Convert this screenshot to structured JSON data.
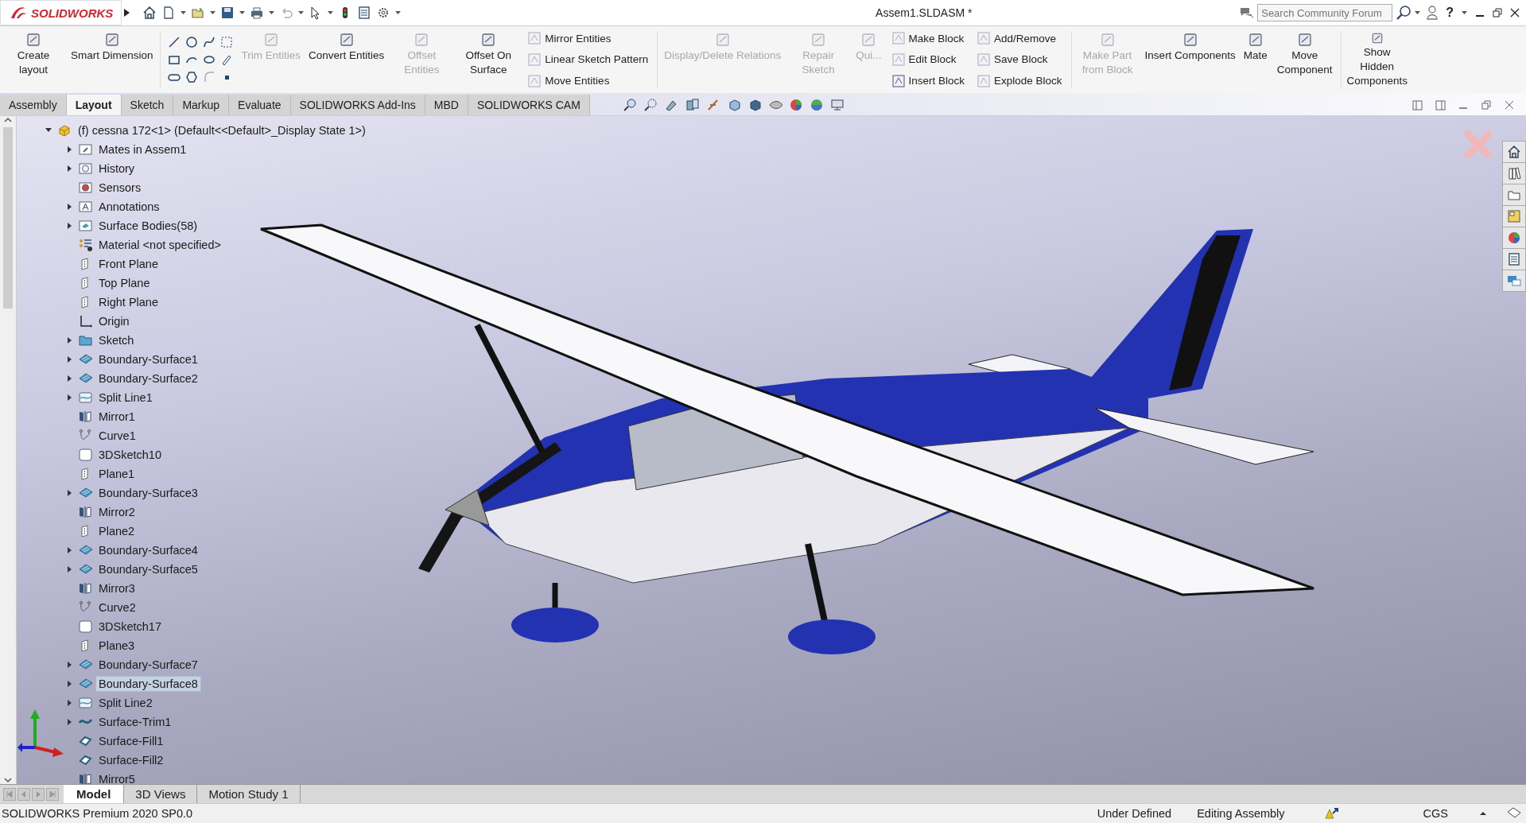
{
  "title_bar": {
    "app": "SOLIDWORKS",
    "document": "Assem1.SLDASM *",
    "search": {
      "placeholder": "Search Community Forum"
    },
    "help": "?"
  },
  "ribbon": [
    {
      "kind": "large",
      "label": "Create layout",
      "disabled": false
    },
    {
      "kind": "large",
      "label": "Smart Dimension",
      "disabled": false
    },
    {
      "kind": "sketch-tools"
    },
    {
      "kind": "large",
      "label": "Trim Entities",
      "disabled": true
    },
    {
      "kind": "large",
      "label": "Convert Entities",
      "disabled": false
    },
    {
      "kind": "large",
      "label": "Offset Entities",
      "disabled": true
    },
    {
      "kind": "large",
      "label": "Offset On Surface",
      "disabled": false
    },
    {
      "kind": "stack",
      "items": [
        {
          "label": "Mirror Entities",
          "disabled": true
        },
        {
          "label": "Linear Sketch Pattern",
          "disabled": true
        },
        {
          "label": "Move Entities",
          "disabled": true
        }
      ]
    },
    {
      "kind": "large",
      "label": "Display/Delete Relations",
      "disabled": true
    },
    {
      "kind": "large",
      "label": "Repair Sketch",
      "disabled": true
    },
    {
      "kind": "large",
      "label": "Qui...",
      "disabled": true
    },
    {
      "kind": "stack",
      "items": [
        {
          "label": "Make Block",
          "disabled": true
        },
        {
          "label": "Edit Block",
          "disabled": true
        },
        {
          "label": "Insert Block",
          "disabled": false
        }
      ]
    },
    {
      "kind": "stack",
      "items": [
        {
          "label": "Add/Remove",
          "disabled": true
        },
        {
          "label": "Save Block",
          "disabled": true
        },
        {
          "label": "Explode Block",
          "disabled": true
        }
      ]
    },
    {
      "kind": "large",
      "label": "Make Part from Block",
      "disabled": true
    },
    {
      "kind": "large",
      "label": "Insert Components",
      "disabled": false
    },
    {
      "kind": "large",
      "label": "Mate",
      "disabled": false
    },
    {
      "kind": "large",
      "label": "Move Component",
      "disabled": false
    },
    {
      "kind": "large",
      "label": "Show Hidden Components",
      "disabled": false
    }
  ],
  "command_tabs": [
    {
      "label": "Assembly",
      "selected": false
    },
    {
      "label": "Layout",
      "selected": true
    },
    {
      "label": "Sketch",
      "selected": false
    },
    {
      "label": "Markup",
      "selected": false
    },
    {
      "label": "Evaluate",
      "selected": false
    },
    {
      "label": "SOLIDWORKS Add-Ins",
      "selected": false
    },
    {
      "label": "MBD",
      "selected": false
    },
    {
      "label": "SOLIDWORKS CAM",
      "selected": false
    }
  ],
  "tree": {
    "label": "(f) cessna 172<1> (Default<<Default>_Display State 1>)",
    "kind": "part",
    "expanded": true,
    "selected": false,
    "children": [
      {
        "label": "Mates in Assem1",
        "kind": "mates",
        "expanded": false,
        "selected": false
      },
      {
        "label": "History",
        "kind": "history",
        "expanded": false,
        "selected": false
      },
      {
        "label": "Sensors",
        "kind": "sensors",
        "selected": false
      },
      {
        "label": "Annotations",
        "kind": "annotations",
        "expanded": false,
        "selected": false
      },
      {
        "label": "Surface Bodies(58)",
        "kind": "bodies",
        "expanded": false,
        "selected": false
      },
      {
        "label": "Material <not specified>",
        "kind": "material",
        "selected": false
      },
      {
        "label": "Front Plane",
        "kind": "plane",
        "selected": false
      },
      {
        "label": "Top Plane",
        "kind": "plane",
        "selected": false
      },
      {
        "label": "Right Plane",
        "kind": "plane",
        "selected": false
      },
      {
        "label": "Origin",
        "kind": "origin",
        "selected": false
      },
      {
        "label": "Sketch",
        "kind": "folder",
        "expanded": false,
        "selected": false
      },
      {
        "label": "Boundary-Surface1",
        "kind": "surface",
        "expanded": false,
        "selected": false
      },
      {
        "label": "Boundary-Surface2",
        "kind": "surface",
        "expanded": false,
        "selected": false
      },
      {
        "label": "Split Line1",
        "kind": "split",
        "expanded": false,
        "selected": false
      },
      {
        "label": "Mirror1",
        "kind": "mirror",
        "selected": false
      },
      {
        "label": "Curve1",
        "kind": "curve",
        "selected": false
      },
      {
        "label": "3DSketch10",
        "kind": "sketch3d",
        "selected": false
      },
      {
        "label": "Plane1",
        "kind": "plane",
        "selected": false
      },
      {
        "label": "Boundary-Surface3",
        "kind": "surface",
        "expanded": false,
        "selected": false
      },
      {
        "label": "Mirror2",
        "kind": "mirror",
        "selected": false
      },
      {
        "label": "Plane2",
        "kind": "plane",
        "selected": false
      },
      {
        "label": "Boundary-Surface4",
        "kind": "surface",
        "expanded": false,
        "selected": false
      },
      {
        "label": "Boundary-Surface5",
        "kind": "surface",
        "expanded": false,
        "selected": false
      },
      {
        "label": "Mirror3",
        "kind": "mirror",
        "selected": false
      },
      {
        "label": "Curve2",
        "kind": "curve",
        "selected": false
      },
      {
        "label": "3DSketch17",
        "kind": "sketch3d",
        "selected": false
      },
      {
        "label": "Plane3",
        "kind": "plane",
        "selected": false
      },
      {
        "label": "Boundary-Surface7",
        "kind": "surface",
        "expanded": false,
        "selected": false
      },
      {
        "label": "Boundary-Surface8",
        "kind": "surface",
        "expanded": false,
        "selected": true
      },
      {
        "label": "Split Line2",
        "kind": "split",
        "expanded": false,
        "selected": false
      },
      {
        "label": "Surface-Trim1",
        "kind": "trim",
        "expanded": false,
        "selected": false
      },
      {
        "label": "Surface-Fill1",
        "kind": "fill",
        "selected": false
      },
      {
        "label": "Surface-Fill2",
        "kind": "fill",
        "selected": false
      },
      {
        "label": "Mirror5",
        "kind": "mirror",
        "selected": false
      }
    ]
  },
  "bottom_tabs": [
    {
      "label": "Model",
      "selected": true
    },
    {
      "label": "3D Views",
      "selected": false
    },
    {
      "label": "Motion Study 1",
      "selected": false
    }
  ],
  "status_bar": {
    "product": "SOLIDWORKS Premium 2020 SP0.0",
    "definition": "Under Defined",
    "mode": "Editing Assembly",
    "units": "CGS"
  }
}
